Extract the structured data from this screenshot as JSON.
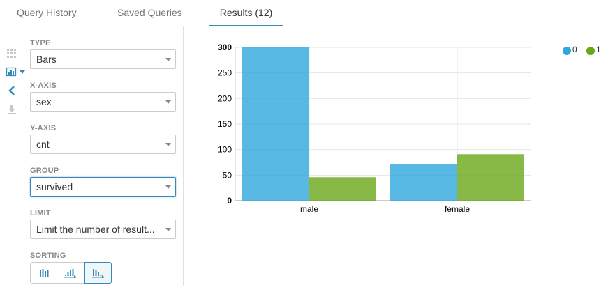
{
  "tabs": [
    {
      "label": "Query History"
    },
    {
      "label": "Saved Queries"
    },
    {
      "label": "Results (12)"
    }
  ],
  "settings": {
    "type": {
      "label": "TYPE",
      "value": "Bars"
    },
    "x_axis": {
      "label": "X-AXIS",
      "value": "sex"
    },
    "y_axis": {
      "label": "Y-AXIS",
      "value": "cnt"
    },
    "group": {
      "label": "GROUP",
      "value": "survived"
    },
    "limit": {
      "label": "LIMIT",
      "placeholder": "Limit the number of result..."
    },
    "sorting": {
      "label": "SORTING"
    }
  },
  "legend": [
    {
      "label": "0",
      "color": "#2ea8dd"
    },
    {
      "label": "1",
      "color": "#6aa818"
    }
  ],
  "chart_data": {
    "type": "bar",
    "categories": [
      "male",
      "female"
    ],
    "series": [
      {
        "name": "0",
        "values": [
          300,
          72
        ],
        "color": "#2ea8dd"
      },
      {
        "name": "1",
        "values": [
          46,
          91
        ],
        "color": "#6aa818"
      }
    ],
    "ylim": [
      0,
      300
    ],
    "yticks": [
      0,
      50,
      100,
      150,
      200,
      250,
      300
    ],
    "grid": true
  }
}
